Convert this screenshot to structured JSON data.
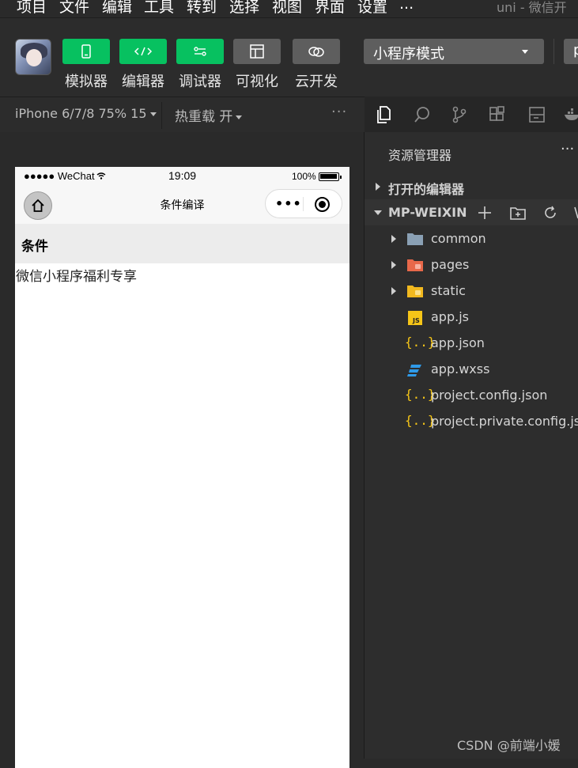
{
  "menu": {
    "items": [
      "项目",
      "文件",
      "编辑",
      "工具",
      "转到",
      "选择",
      "视图",
      "界面",
      "设置",
      "..."
    ],
    "window_title": "uni - 微信开"
  },
  "toolbar": {
    "buttons": [
      {
        "label": "模拟器",
        "icon": "phone-icon",
        "color": "#07c160"
      },
      {
        "label": "编辑器",
        "icon": "code-icon",
        "color": "#07c160"
      },
      {
        "label": "调试器",
        "icon": "debug-icon",
        "color": "#07c160"
      },
      {
        "label": "可视化",
        "icon": "layout-icon",
        "color": "#5e5e5e"
      },
      {
        "label": "云开发",
        "icon": "cloud-icon",
        "color": "#5e5e5e"
      }
    ],
    "mode": "小程序模式",
    "partial_label": "p"
  },
  "simulator": {
    "device": "iPhone 6/7/8 75% 15",
    "hot_reload": "热重载 开",
    "more": "···"
  },
  "phone": {
    "status_left": "●●●●● WeChat",
    "time": "19:09",
    "battery": "100%",
    "nav_title": "条件编译",
    "capsule_dots": "•••",
    "section_title": "条件",
    "content_text": "微信小程序福利专享"
  },
  "explorer": {
    "title": "资源管理器",
    "more": "···",
    "open_editors": "打开的编辑器",
    "project": "MP-WEIXIN",
    "files": [
      {
        "name": "common",
        "type": "folder"
      },
      {
        "name": "pages",
        "type": "folder"
      },
      {
        "name": "static",
        "type": "folder"
      },
      {
        "name": "app.js",
        "type": "js"
      },
      {
        "name": "app.json",
        "type": "json"
      },
      {
        "name": "app.wxss",
        "type": "wxss"
      },
      {
        "name": "project.config.json",
        "type": "json"
      },
      {
        "name": "project.private.config.json",
        "type": "json"
      }
    ]
  },
  "watermark": "CSDN @前端小媛",
  "colors": {
    "accent_green": "#07c160",
    "folder_gray": "#8aa0b4",
    "folder_orange": "#e8684a",
    "folder_yellow": "#f2b91f",
    "js_yellow": "#f5c518",
    "wxss_blue": "#2f9ae8"
  }
}
